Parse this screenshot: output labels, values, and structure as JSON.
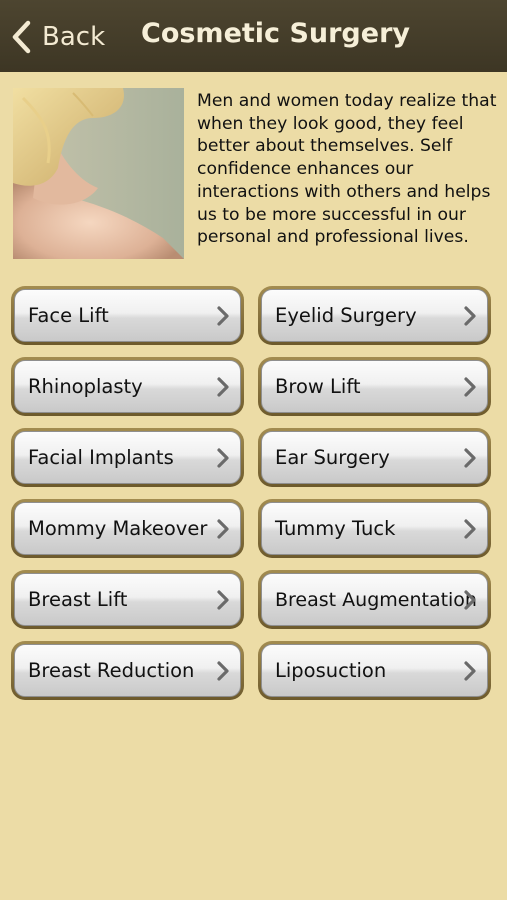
{
  "navbar": {
    "back_label": "Back",
    "title": "Cosmetic Surgery"
  },
  "intro": {
    "text": "Men and women today realize that when they look good, they feel better about themselves. Self confidence enhances our interactions with others and helps us to be more successful in our personal and professional lives."
  },
  "procedures": [
    {
      "label": "Face Lift"
    },
    {
      "label": "Eyelid Surgery"
    },
    {
      "label": "Rhinoplasty"
    },
    {
      "label": "Brow Lift"
    },
    {
      "label": "Facial Implants"
    },
    {
      "label": "Ear Surgery"
    },
    {
      "label": "Mommy Makeover"
    },
    {
      "label": "Tummy Tuck"
    },
    {
      "label": "Breast Lift"
    },
    {
      "label": "Breast Augmentation"
    },
    {
      "label": "Breast Reduction"
    },
    {
      "label": "Liposuction"
    }
  ],
  "colors": {
    "background": "#ecdca6",
    "navbar": "#423a28",
    "button_border": "#8c7740"
  }
}
